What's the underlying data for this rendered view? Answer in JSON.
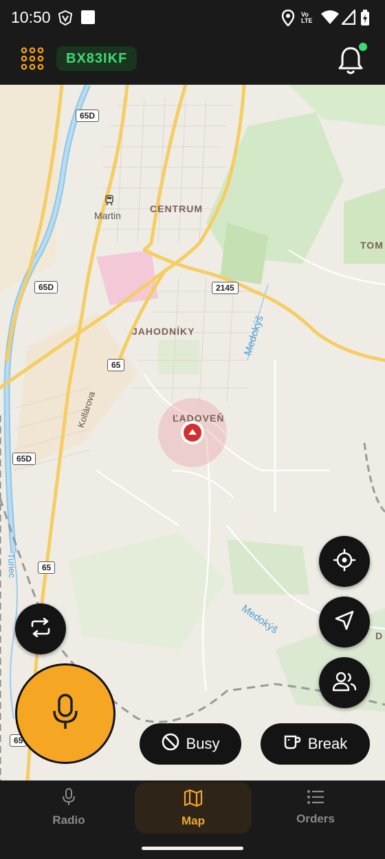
{
  "status_bar": {
    "time": "10:50",
    "icons": [
      "shield-icon",
      "square-icon",
      "location-icon",
      "volte-icon",
      "wifi-icon",
      "signal-icon",
      "battery-icon"
    ],
    "volte_text": "Vo LTE"
  },
  "app_bar": {
    "callsign": "BX83IKF",
    "menu_icon": "grid-menu-icon",
    "notification_icon": "bell-icon",
    "notification_dot_color": "#3ddc73"
  },
  "map": {
    "place_labels": {
      "centrum": "CENTRUM",
      "jahodniky": "JAHODNÍKY",
      "ladoven": "ĽADOVEŇ",
      "tom": "TOM",
      "martin": "Martin",
      "kollarova": "Kollárova",
      "d": "D"
    },
    "road_shields": {
      "r65d_top": "65D",
      "r65d_mid": "65D",
      "r65d_low": "65D",
      "r2145": "2145",
      "r65_mid": "65",
      "r65_low": "65",
      "r65_bottom": "65"
    },
    "water_labels": {
      "medokys_1": "Medokýš",
      "medokys_2": "Medokýš",
      "turiec": "Turiec"
    }
  },
  "actions": {
    "busy_label": "Busy",
    "break_label": "Break"
  },
  "bottom_nav": {
    "radio_label": "Radio",
    "map_label": "Map",
    "orders_label": "Orders",
    "active": "Map"
  },
  "colors": {
    "accent": "#f5a623",
    "callsign_text": "#3ddc73",
    "dark_bg": "#1a1a1a",
    "location_marker": "#d32f2f"
  }
}
